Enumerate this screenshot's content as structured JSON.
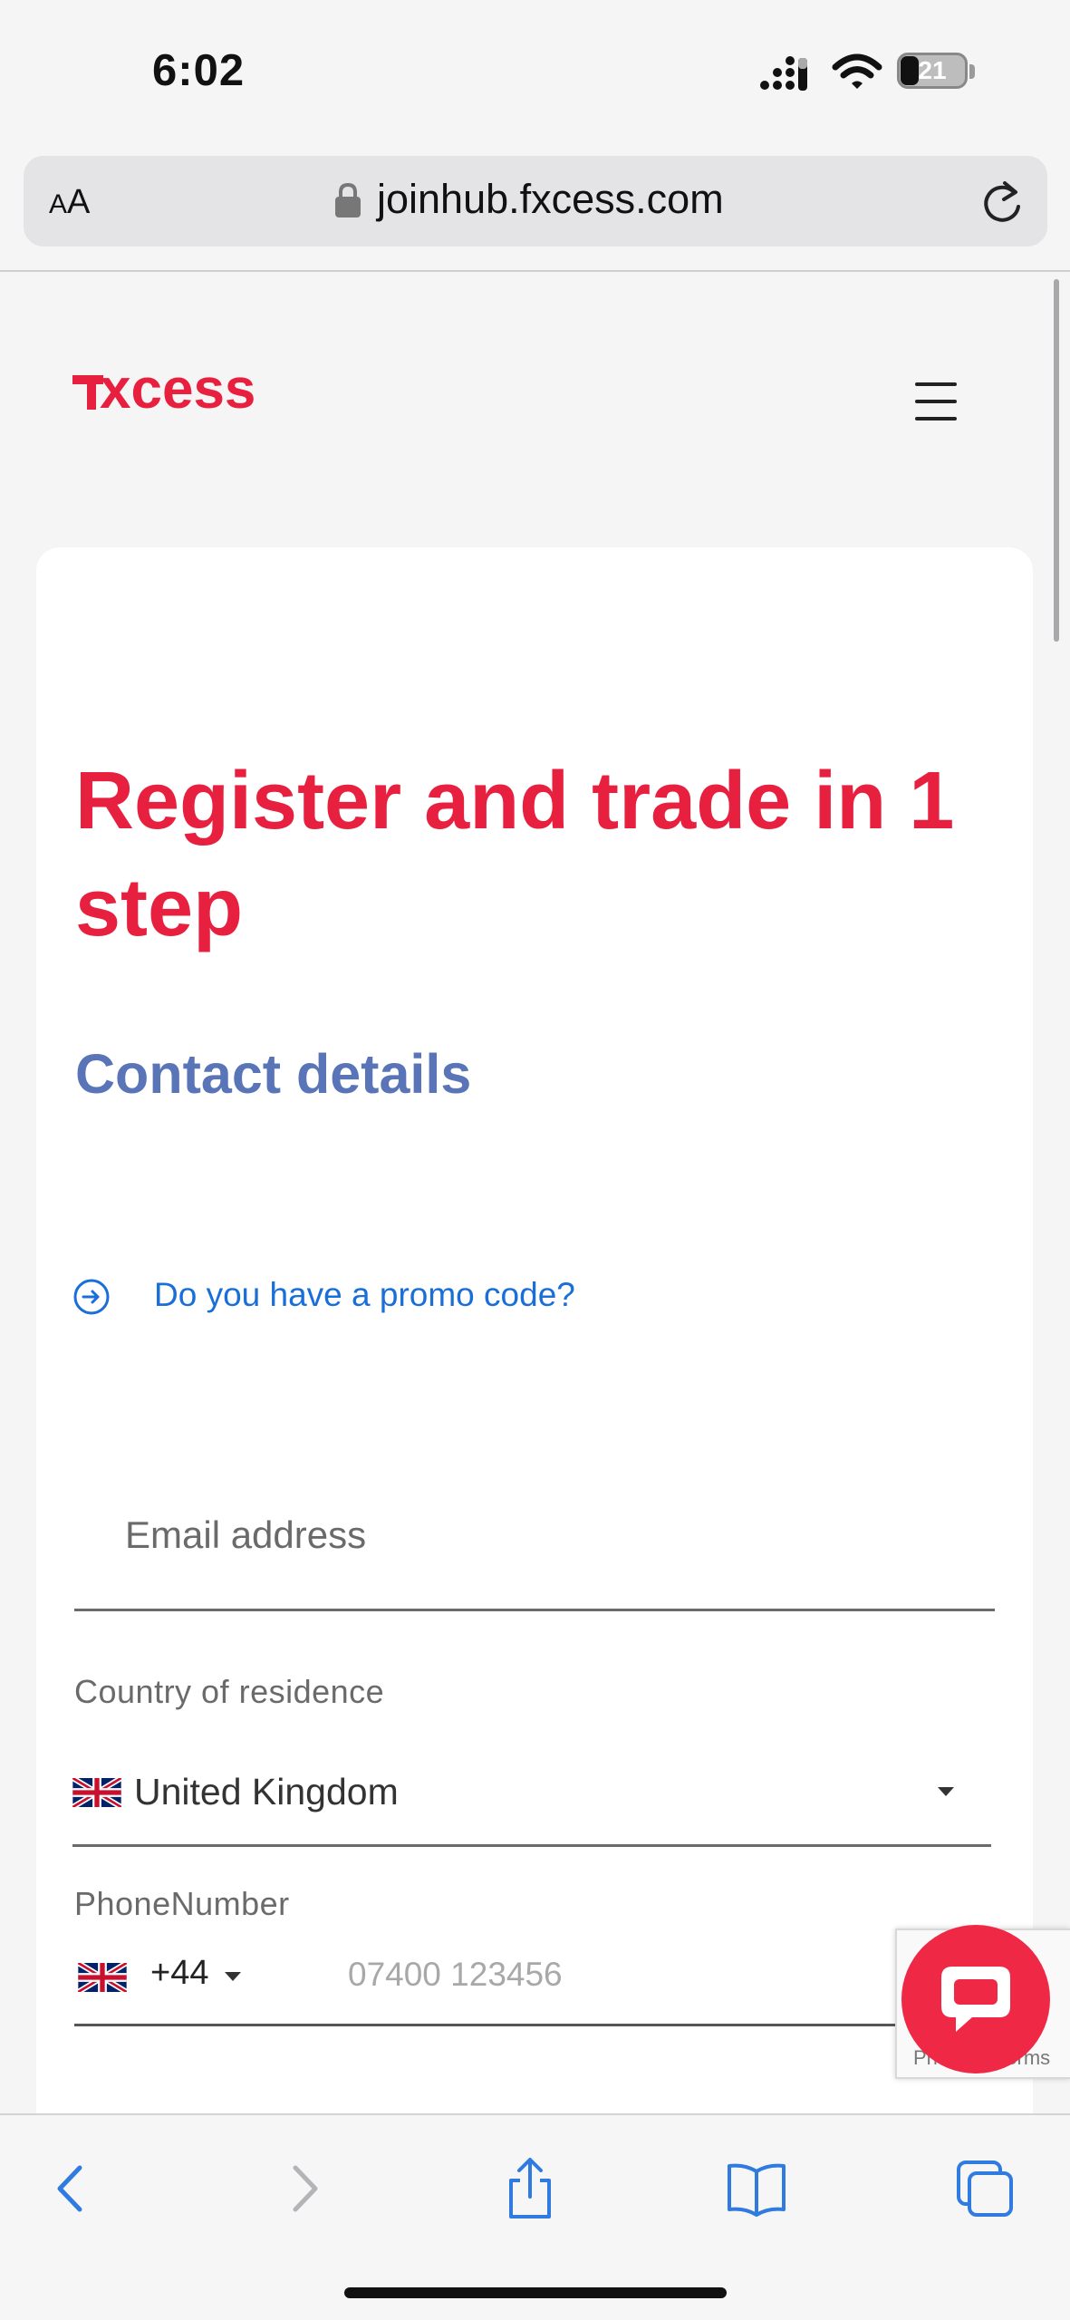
{
  "status_bar": {
    "time": "6:02",
    "battery": "21"
  },
  "browser": {
    "text_size_label_small": "A",
    "text_size_label_large": "A",
    "url": "joinhub.fxcess.com"
  },
  "site": {
    "brand": "fxcess",
    "brand_color": "#e8203f"
  },
  "form": {
    "headline": "Register and trade in 1 step",
    "section_title": "Contact details",
    "promo_link": "Do you have a promo code?",
    "email_placeholder": "Email address",
    "country_label": "Country of residence",
    "country_value": "United Kingdom",
    "phone_label": "PhoneNumber",
    "phone_code": "+44",
    "phone_placeholder": "07400 123456"
  },
  "recaptcha": {
    "text": "Privacy - Terms"
  },
  "colors": {
    "accent": "#e8203f",
    "section_title": "#5a74b8",
    "link": "#1a6ed8",
    "toolbar_icons": "#2f7be0",
    "chat": "#ef2846"
  },
  "icons": {
    "lock": "lock-icon",
    "reload": "reload-icon",
    "menu": "hamburger-menu-icon",
    "promo": "arrow-circle-right-icon",
    "chat": "chat-bubble-icon",
    "back": "chevron-left-icon",
    "forward": "chevron-right-icon",
    "share": "share-icon",
    "bookmarks": "book-icon",
    "tabs": "tabs-icon"
  }
}
